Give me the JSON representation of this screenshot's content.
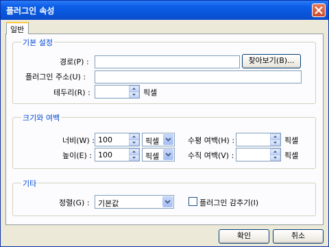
{
  "window": {
    "title": "플러그인 속성"
  },
  "tabs": [
    {
      "label": "일반"
    }
  ],
  "basic": {
    "title": "기본 설정",
    "path_label": "경로(P) :",
    "path_value": "",
    "browse_label": "찾아보기(B)...",
    "name_label": "플러그인 주소(U) :",
    "name_value": "",
    "border_label": "테두리(R) :",
    "border_value": "",
    "border_unit": "픽셀"
  },
  "size": {
    "title": "크기와 여백",
    "width_label": "너비(W) :",
    "width_value": "100",
    "width_unit": "픽셀",
    "height_label": "높이(E) :",
    "height_value": "100",
    "height_unit": "픽셀",
    "hspace_label": "수평 여백(H) :",
    "hspace_value": "",
    "hspace_unit": "픽셀",
    "vspace_label": "수직 여백(V) :",
    "vspace_value": "",
    "vspace_unit": "픽셀"
  },
  "other": {
    "title": "기타",
    "align_label": "정렬(G) :",
    "align_value": "기본값",
    "hide_label": "플러그인 감추기(I)",
    "hide_checked": false
  },
  "footer": {
    "ok_label": "확인",
    "cancel_label": "취소"
  },
  "icons": {
    "close": "close-icon",
    "spin_up": "arrow-up-icon",
    "spin_down": "arrow-down-icon",
    "dropdown": "chevron-down-icon"
  }
}
